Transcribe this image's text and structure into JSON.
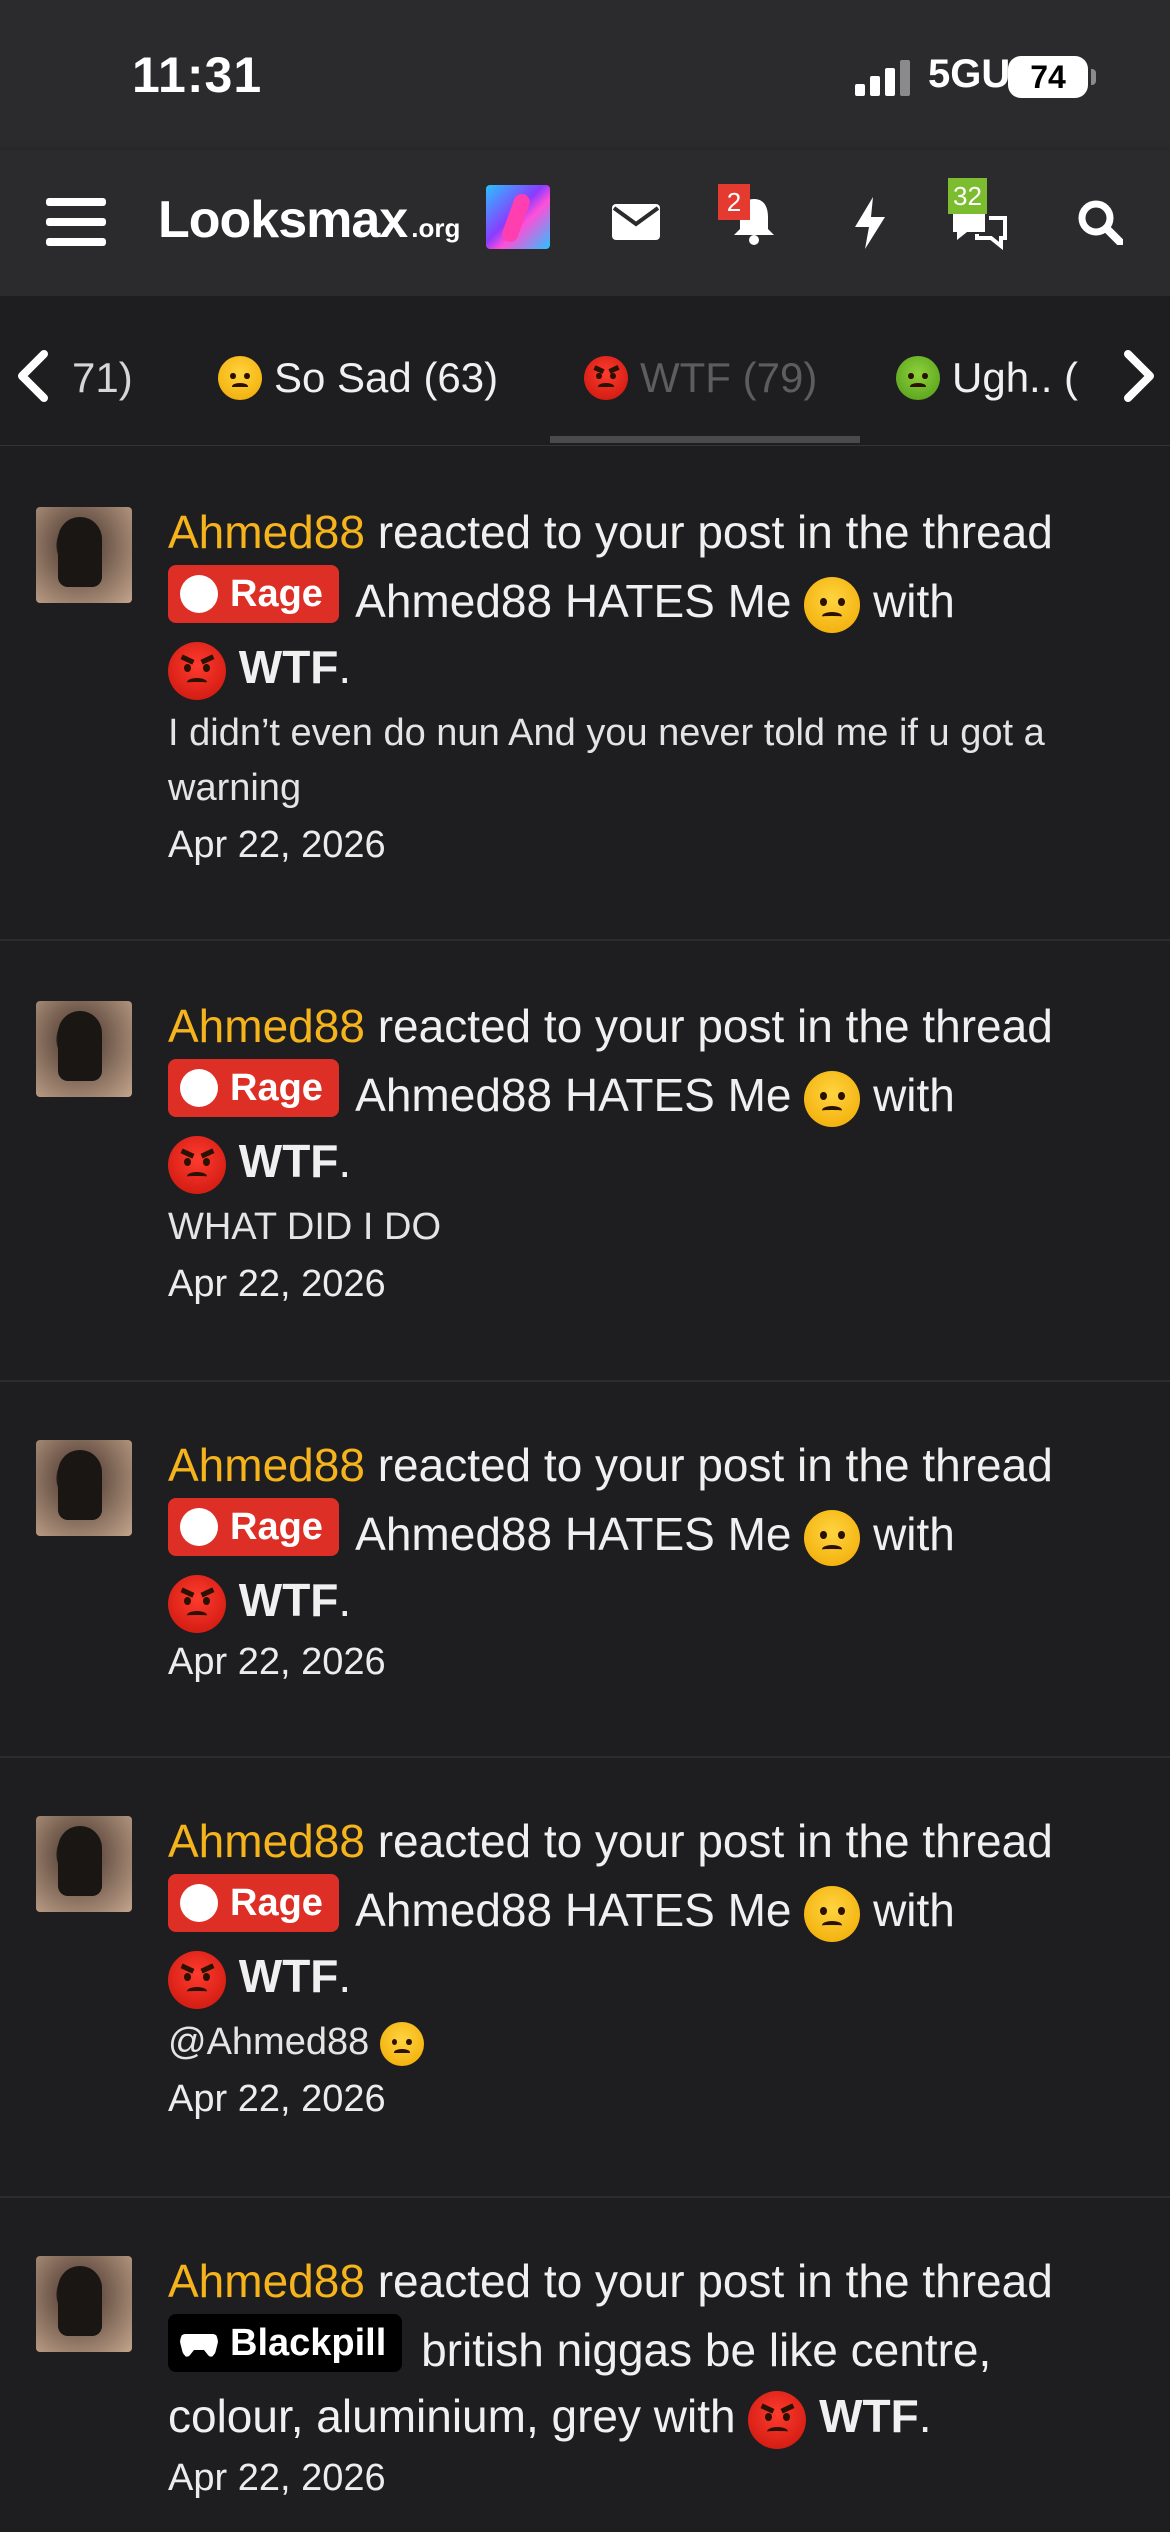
{
  "status_bar": {
    "time": "11:31",
    "network": "5GUC",
    "battery": "74"
  },
  "nav": {
    "logo_main": "Looksmax",
    "logo_suffix": ".org",
    "alerts_badge": "2",
    "conversations_badge": "32",
    "icons": [
      "menu-icon",
      "mail-icon",
      "bell-icon",
      "lightning-icon",
      "chat-icon",
      "search-icon"
    ]
  },
  "tabs": {
    "items": [
      {
        "label": "71)",
        "emoji": "none"
      },
      {
        "label": "So Sad (63)",
        "emoji": "sad-face"
      },
      {
        "label": "WTF (79)",
        "emoji": "angry-face",
        "active": true
      },
      {
        "label": "Ugh.. (",
        "emoji": "sick-face"
      }
    ]
  },
  "alerts": [
    {
      "user": "Ahmed88",
      "action": "reacted to your post in the thread",
      "prefix": "Rage",
      "thread_title": "Ahmed88 HATES Me",
      "with_text": "with",
      "reaction": "WTF",
      "snippet": "I didn’t even do nun And you never told me if u got a warning",
      "date": "Apr 22, 2026"
    },
    {
      "user": "Ahmed88",
      "action": "reacted to your post in the thread",
      "prefix": "Rage",
      "thread_title": "Ahmed88 HATES Me",
      "with_text": "with",
      "reaction": "WTF",
      "snippet": "WHAT DID I DO",
      "date": "Apr 22, 2026"
    },
    {
      "user": "Ahmed88",
      "action": "reacted to your post in the thread",
      "prefix": "Rage",
      "thread_title": "Ahmed88 HATES Me",
      "with_text": "with",
      "reaction": "WTF",
      "snippet": "",
      "date": "Apr 22, 2026"
    },
    {
      "user": "Ahmed88",
      "action": "reacted to your post in the thread",
      "prefix": "Rage",
      "thread_title": "Ahmed88 HATES Me",
      "with_text": "with",
      "reaction": "WTF",
      "snippet": "@Ahmed88",
      "date": "Apr 22, 2026"
    },
    {
      "user": "Ahmed88",
      "action": "reacted to your post in the thread",
      "prefix": "Blackpill",
      "thread_title": "british niggas be like centre, colour, aluminium, grey",
      "with_text": "with",
      "reaction": "WTF",
      "snippet": "",
      "date": "Apr 22, 2026"
    }
  ],
  "colors": {
    "username": "#f6b41c",
    "rage_prefix": "#de2f27",
    "background": "#1e1e20",
    "header": "#2b2b2d"
  }
}
